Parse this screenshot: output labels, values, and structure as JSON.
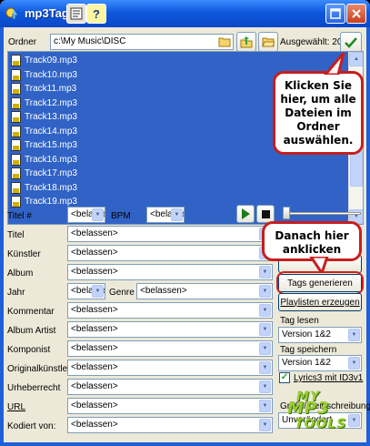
{
  "window": {
    "title": "mp3Tag"
  },
  "toolbar": {
    "folder_label": "Ordner",
    "folder_path": "c:\\My Music\\DISC",
    "selected_label": "Ausgewählt: 20"
  },
  "files": [
    "Track09.mp3",
    "Track10.mp3",
    "Track11.mp3",
    "Track12.mp3",
    "Track13.mp3",
    "Track14.mp3",
    "Track15.mp3",
    "Track16.mp3",
    "Track17.mp3",
    "Track18.mp3",
    "Track19.mp3"
  ],
  "callouts": {
    "select_all": "Klicken Sie hier, um alle Dateien im Ordner auswählen.",
    "then_click": "Danach hier anklicken"
  },
  "form": {
    "track_label": "Titel #",
    "track_value": "<belassen>",
    "bpm_label": "BPM",
    "bpm_value": "<belassen>",
    "title_label": "Titel",
    "title_value": "<belassen>",
    "artist_label": "Künstler",
    "artist_value": "<belassen>",
    "album_label": "Album",
    "album_value": "<belassen>",
    "year_label": "Jahr",
    "year_value": "<belassen>",
    "genre_label": "Genre",
    "genre_value": "<belassen>",
    "comment_label": "Kommentar",
    "comment_value": "<belassen>",
    "album_artist_label": "Album Artist",
    "album_artist_value": "<belassen>",
    "composer_label": "Komponist",
    "composer_value": "<belassen>",
    "orig_artist_label": "Originalkünstler",
    "orig_artist_value": "<belassen>",
    "copyright_label": "Urheberrecht",
    "copyright_value": "<belassen>",
    "url_label": "URL",
    "url_value": "<belassen>",
    "encoded_label": "Kodiert von:",
    "encoded_value": "<belassen>"
  },
  "right_panel": {
    "generate_tags": "Tags generieren",
    "create_playlists": "Playlisten erzeugen",
    "read_tag_label": "Tag lesen",
    "read_tag_value": "Version 1&2",
    "save_tag_label": "Tag speichern",
    "save_tag_value": "Version 1&2",
    "lyrics_label": "Lyrics3 mit ID3v1",
    "case_label": "Groß-/Kleinschreibung",
    "case_value": "Unverändert"
  },
  "logo": {
    "line1": "MY",
    "line2": "MP3",
    "line3": "TOOLS"
  },
  "colors": {
    "selection": "#3163c6",
    "callout_border": "#c81e1e",
    "titlebar": "#0f58de"
  }
}
